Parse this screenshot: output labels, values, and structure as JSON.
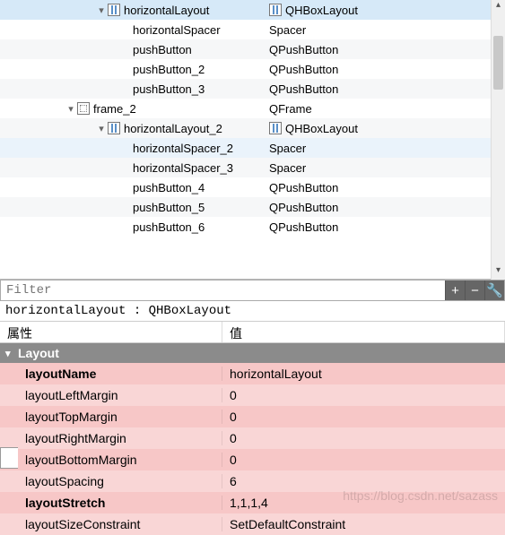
{
  "tree": {
    "rows": [
      {
        "indent": 106,
        "arrow": "down",
        "icon": "h",
        "name": "horizontalLayout",
        "classIcon": "h",
        "class": "QHBoxLayout",
        "sel": true
      },
      {
        "indent": 134,
        "arrow": "",
        "icon": "",
        "name": "horizontalSpacer",
        "classIcon": "",
        "class": "Spacer"
      },
      {
        "indent": 134,
        "arrow": "",
        "icon": "",
        "name": "pushButton",
        "classIcon": "",
        "class": "QPushButton",
        "alt": true
      },
      {
        "indent": 134,
        "arrow": "",
        "icon": "",
        "name": "pushButton_2",
        "classIcon": "",
        "class": "QPushButton"
      },
      {
        "indent": 134,
        "arrow": "",
        "icon": "",
        "name": "pushButton_3",
        "classIcon": "",
        "class": "QPushButton",
        "alt": true
      },
      {
        "indent": 72,
        "arrow": "down",
        "icon": "frame",
        "name": "frame_2",
        "classIcon": "",
        "class": "QFrame"
      },
      {
        "indent": 106,
        "arrow": "down",
        "icon": "h",
        "name": "horizontalLayout_2",
        "classIcon": "h",
        "class": "QHBoxLayout",
        "alt": true
      },
      {
        "indent": 134,
        "arrow": "",
        "icon": "",
        "name": "horizontalSpacer_2",
        "classIcon": "",
        "class": "Spacer",
        "sel1": true
      },
      {
        "indent": 134,
        "arrow": "",
        "icon": "",
        "name": "horizontalSpacer_3",
        "classIcon": "",
        "class": "Spacer",
        "alt": true
      },
      {
        "indent": 134,
        "arrow": "",
        "icon": "",
        "name": "pushButton_4",
        "classIcon": "",
        "class": "QPushButton"
      },
      {
        "indent": 134,
        "arrow": "",
        "icon": "",
        "name": "pushButton_5",
        "classIcon": "",
        "class": "QPushButton",
        "alt": true
      },
      {
        "indent": 134,
        "arrow": "",
        "icon": "",
        "name": "pushButton_6",
        "classIcon": "",
        "class": "QPushButton"
      }
    ]
  },
  "filter": {
    "placeholder": "Filter"
  },
  "selection": "horizontalLayout : QHBoxLayout",
  "propHeader": {
    "name": "属性",
    "value": "值"
  },
  "group": "Layout",
  "props": [
    {
      "name": "layoutName",
      "value": "horizontalLayout",
      "bold": true
    },
    {
      "name": "layoutLeftMargin",
      "value": "0",
      "alt": true
    },
    {
      "name": "layoutTopMargin",
      "value": "0"
    },
    {
      "name": "layoutRightMargin",
      "value": "0",
      "alt": true
    },
    {
      "name": "layoutBottomMargin",
      "value": "0"
    },
    {
      "name": "layoutSpacing",
      "value": "6",
      "alt": true
    },
    {
      "name": "layoutStretch",
      "value": "1,1,1,4",
      "bold": true
    },
    {
      "name": "layoutSizeConstraint",
      "value": "SetDefaultConstraint",
      "alt": true
    }
  ],
  "watermark": "https://blog.csdn.net/sazass"
}
